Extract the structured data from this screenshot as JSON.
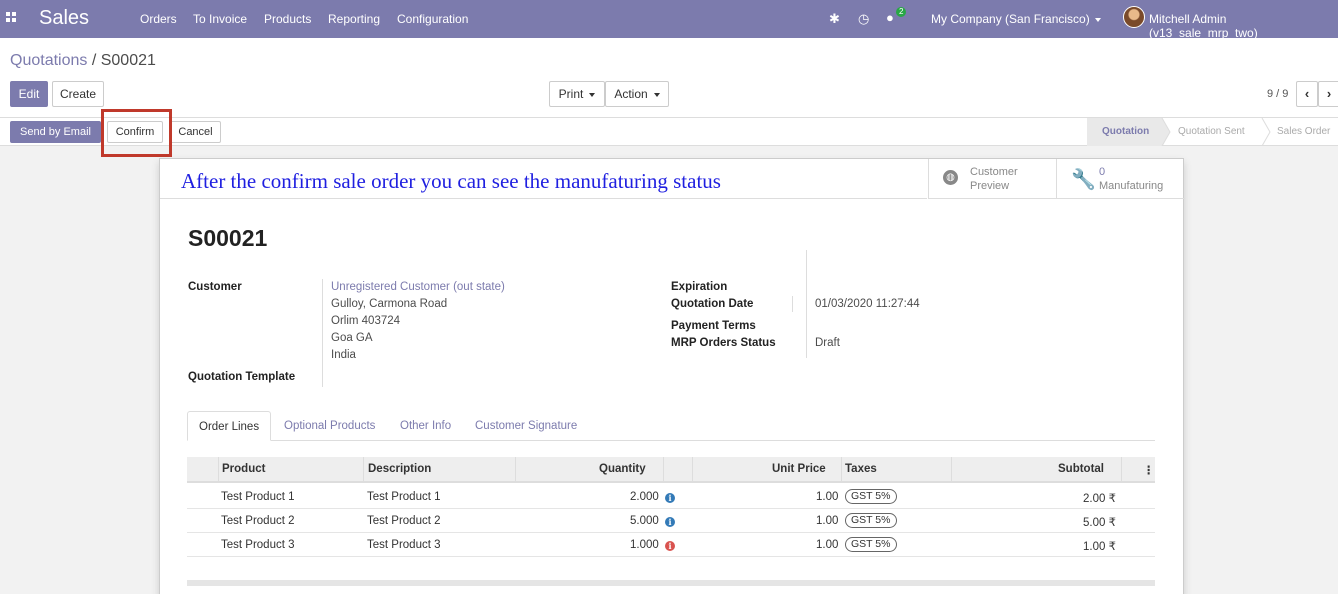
{
  "navbar": {
    "app_name": "Sales",
    "menu": [
      "Orders",
      "To Invoice",
      "Products",
      "Reporting",
      "Configuration"
    ],
    "chat_count": "2",
    "company": "My Company (San Francisco)",
    "user": "Mitchell Admin (v13_sale_mrp_two)"
  },
  "breadcrumb": {
    "parent": "Quotations",
    "sep": " / ",
    "current": "S00021"
  },
  "buttons": {
    "edit": "Edit",
    "create": "Create",
    "print": "Print",
    "action": "Action",
    "send_email": "Send by Email",
    "confirm": "Confirm",
    "cancel": "Cancel"
  },
  "pager": {
    "text": "9 / 9"
  },
  "stages": [
    "Quotation",
    "Quotation Sent",
    "Sales Order"
  ],
  "annotation": "After the confirm sale order you can see the manufaturing status",
  "smart_buttons": {
    "preview_line1": "Customer",
    "preview_line2": "Preview",
    "mfg_count": "0",
    "mfg_label": "Manufaturing"
  },
  "record": {
    "name": "S00021",
    "customer_label": "Customer",
    "customer_name": "Unregistered Customer (out state)",
    "address": [
      "Gulloy, Carmona Road",
      "Orlim 403724",
      "Goa GA",
      "India"
    ],
    "template_label": "Quotation Template",
    "expiration_label": "Expiration",
    "qdate_label": "Quotation Date",
    "qdate_value": "01/03/2020 11:27:44",
    "payment_label": "Payment Terms",
    "mrp_label": "MRP Orders Status",
    "mrp_value": "Draft"
  },
  "tabs": [
    "Order Lines",
    "Optional Products",
    "Other Info",
    "Customer Signature"
  ],
  "table": {
    "headers": [
      "Product",
      "Description",
      "Quantity",
      "Unit Price",
      "Taxes",
      "Subtotal"
    ],
    "rows": [
      {
        "product": "Test Product 1",
        "description": "Test Product 1",
        "qty": "2.000",
        "price": "1.00",
        "tax": "GST 5%",
        "subtotal": "2.00 ₹",
        "info_color": "#337ab7"
      },
      {
        "product": "Test Product 2",
        "description": "Test Product 2",
        "qty": "5.000",
        "price": "1.00",
        "tax": "GST 5%",
        "subtotal": "5.00 ₹",
        "info_color": "#337ab7"
      },
      {
        "product": "Test Product 3",
        "description": "Test Product 3",
        "qty": "1.000",
        "price": "1.00",
        "tax": "GST 5%",
        "subtotal": "1.00 ₹",
        "info_color": "#d9534f"
      }
    ]
  },
  "colors": {
    "brand": "#7c7bad",
    "annotation": "#1f1fe0",
    "highlight": "#c0392b"
  }
}
